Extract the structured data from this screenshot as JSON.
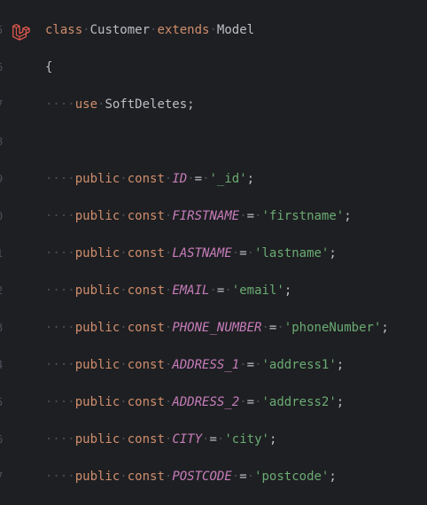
{
  "editor": {
    "language_icon": "laravel-icon",
    "colors": {
      "background": "#1e1f22",
      "keyword": "#cf8e6d",
      "constant": "#c77dbb",
      "string": "#6aab73",
      "text": "#bcbec4",
      "line_number": "#4b5059"
    },
    "line_numbers": [
      "5",
      "6",
      "7",
      "8",
      "9",
      "0",
      "1",
      "2",
      "3",
      "4",
      "5",
      "6",
      "7"
    ],
    "lines": [
      {
        "indent": "",
        "tokens": [
          {
            "t": "class",
            "k": "kw"
          },
          {
            "t": " ",
            "k": "ws"
          },
          {
            "t": "Customer",
            "k": "cls"
          },
          {
            "t": " ",
            "k": "ws"
          },
          {
            "t": "extends",
            "k": "kw"
          },
          {
            "t": " ",
            "k": "ws"
          },
          {
            "t": "Model",
            "k": "cls"
          }
        ]
      },
      {
        "indent": "",
        "tokens": [
          {
            "t": "{",
            "k": "punc"
          }
        ]
      },
      {
        "indent": "····",
        "tokens": [
          {
            "t": "use",
            "k": "kw"
          },
          {
            "t": " ",
            "k": "ws"
          },
          {
            "t": "SoftDeletes;",
            "k": "cls"
          }
        ]
      },
      {
        "indent": "",
        "tokens": []
      },
      {
        "indent": "····",
        "tokens": [
          {
            "t": "public",
            "k": "kw"
          },
          {
            "t": " ",
            "k": "ws"
          },
          {
            "t": "const",
            "k": "kw"
          },
          {
            "t": " ",
            "k": "ws"
          },
          {
            "t": "ID",
            "k": "const"
          },
          {
            "t": " ",
            "k": "ws"
          },
          {
            "t": "=",
            "k": "punc"
          },
          {
            "t": " ",
            "k": "ws"
          },
          {
            "t": "'_id'",
            "k": "str"
          },
          {
            "t": ";",
            "k": "punc"
          }
        ]
      },
      {
        "indent": "····",
        "tokens": [
          {
            "t": "public",
            "k": "kw"
          },
          {
            "t": " ",
            "k": "ws"
          },
          {
            "t": "const",
            "k": "kw"
          },
          {
            "t": " ",
            "k": "ws"
          },
          {
            "t": "FIRSTNAME",
            "k": "const"
          },
          {
            "t": " ",
            "k": "ws"
          },
          {
            "t": "=",
            "k": "punc"
          },
          {
            "t": " ",
            "k": "ws"
          },
          {
            "t": "'firstname'",
            "k": "str"
          },
          {
            "t": ";",
            "k": "punc"
          }
        ]
      },
      {
        "indent": "····",
        "tokens": [
          {
            "t": "public",
            "k": "kw"
          },
          {
            "t": " ",
            "k": "ws"
          },
          {
            "t": "const",
            "k": "kw"
          },
          {
            "t": " ",
            "k": "ws"
          },
          {
            "t": "LASTNAME",
            "k": "const"
          },
          {
            "t": " ",
            "k": "ws"
          },
          {
            "t": "=",
            "k": "punc"
          },
          {
            "t": " ",
            "k": "ws"
          },
          {
            "t": "'lastname'",
            "k": "str"
          },
          {
            "t": ";",
            "k": "punc"
          }
        ]
      },
      {
        "indent": "····",
        "tokens": [
          {
            "t": "public",
            "k": "kw"
          },
          {
            "t": " ",
            "k": "ws"
          },
          {
            "t": "const",
            "k": "kw"
          },
          {
            "t": " ",
            "k": "ws"
          },
          {
            "t": "EMAIL",
            "k": "const"
          },
          {
            "t": " ",
            "k": "ws"
          },
          {
            "t": "=",
            "k": "punc"
          },
          {
            "t": " ",
            "k": "ws"
          },
          {
            "t": "'email'",
            "k": "str"
          },
          {
            "t": ";",
            "k": "punc"
          }
        ]
      },
      {
        "indent": "····",
        "tokens": [
          {
            "t": "public",
            "k": "kw"
          },
          {
            "t": " ",
            "k": "ws"
          },
          {
            "t": "const",
            "k": "kw"
          },
          {
            "t": " ",
            "k": "ws"
          },
          {
            "t": "PHONE_NUMBER",
            "k": "const"
          },
          {
            "t": " ",
            "k": "ws"
          },
          {
            "t": "=",
            "k": "punc"
          },
          {
            "t": " ",
            "k": "ws"
          },
          {
            "t": "'phoneNumber'",
            "k": "str"
          },
          {
            "t": ";",
            "k": "punc"
          }
        ]
      },
      {
        "indent": "····",
        "tokens": [
          {
            "t": "public",
            "k": "kw"
          },
          {
            "t": " ",
            "k": "ws"
          },
          {
            "t": "const",
            "k": "kw"
          },
          {
            "t": " ",
            "k": "ws"
          },
          {
            "t": "ADDRESS_1",
            "k": "const"
          },
          {
            "t": " ",
            "k": "ws"
          },
          {
            "t": "=",
            "k": "punc"
          },
          {
            "t": " ",
            "k": "ws"
          },
          {
            "t": "'address1'",
            "k": "str"
          },
          {
            "t": ";",
            "k": "punc"
          }
        ]
      },
      {
        "indent": "····",
        "tokens": [
          {
            "t": "public",
            "k": "kw"
          },
          {
            "t": " ",
            "k": "ws"
          },
          {
            "t": "const",
            "k": "kw"
          },
          {
            "t": " ",
            "k": "ws"
          },
          {
            "t": "ADDRESS_2",
            "k": "const"
          },
          {
            "t": " ",
            "k": "ws"
          },
          {
            "t": "=",
            "k": "punc"
          },
          {
            "t": " ",
            "k": "ws"
          },
          {
            "t": "'address2'",
            "k": "str"
          },
          {
            "t": ";",
            "k": "punc"
          }
        ]
      },
      {
        "indent": "····",
        "tokens": [
          {
            "t": "public",
            "k": "kw"
          },
          {
            "t": " ",
            "k": "ws"
          },
          {
            "t": "const",
            "k": "kw"
          },
          {
            "t": " ",
            "k": "ws"
          },
          {
            "t": "CITY",
            "k": "const"
          },
          {
            "t": " ",
            "k": "ws"
          },
          {
            "t": "=",
            "k": "punc"
          },
          {
            "t": " ",
            "k": "ws"
          },
          {
            "t": "'city'",
            "k": "str"
          },
          {
            "t": ";",
            "k": "punc"
          }
        ]
      },
      {
        "indent": "····",
        "tokens": [
          {
            "t": "public",
            "k": "kw"
          },
          {
            "t": " ",
            "k": "ws"
          },
          {
            "t": "const",
            "k": "kw"
          },
          {
            "t": " ",
            "k": "ws"
          },
          {
            "t": "POSTCODE",
            "k": "const"
          },
          {
            "t": " ",
            "k": "ws"
          },
          {
            "t": "=",
            "k": "punc"
          },
          {
            "t": " ",
            "k": "ws"
          },
          {
            "t": "'postcode'",
            "k": "str"
          },
          {
            "t": ";",
            "k": "punc"
          }
        ]
      }
    ]
  }
}
